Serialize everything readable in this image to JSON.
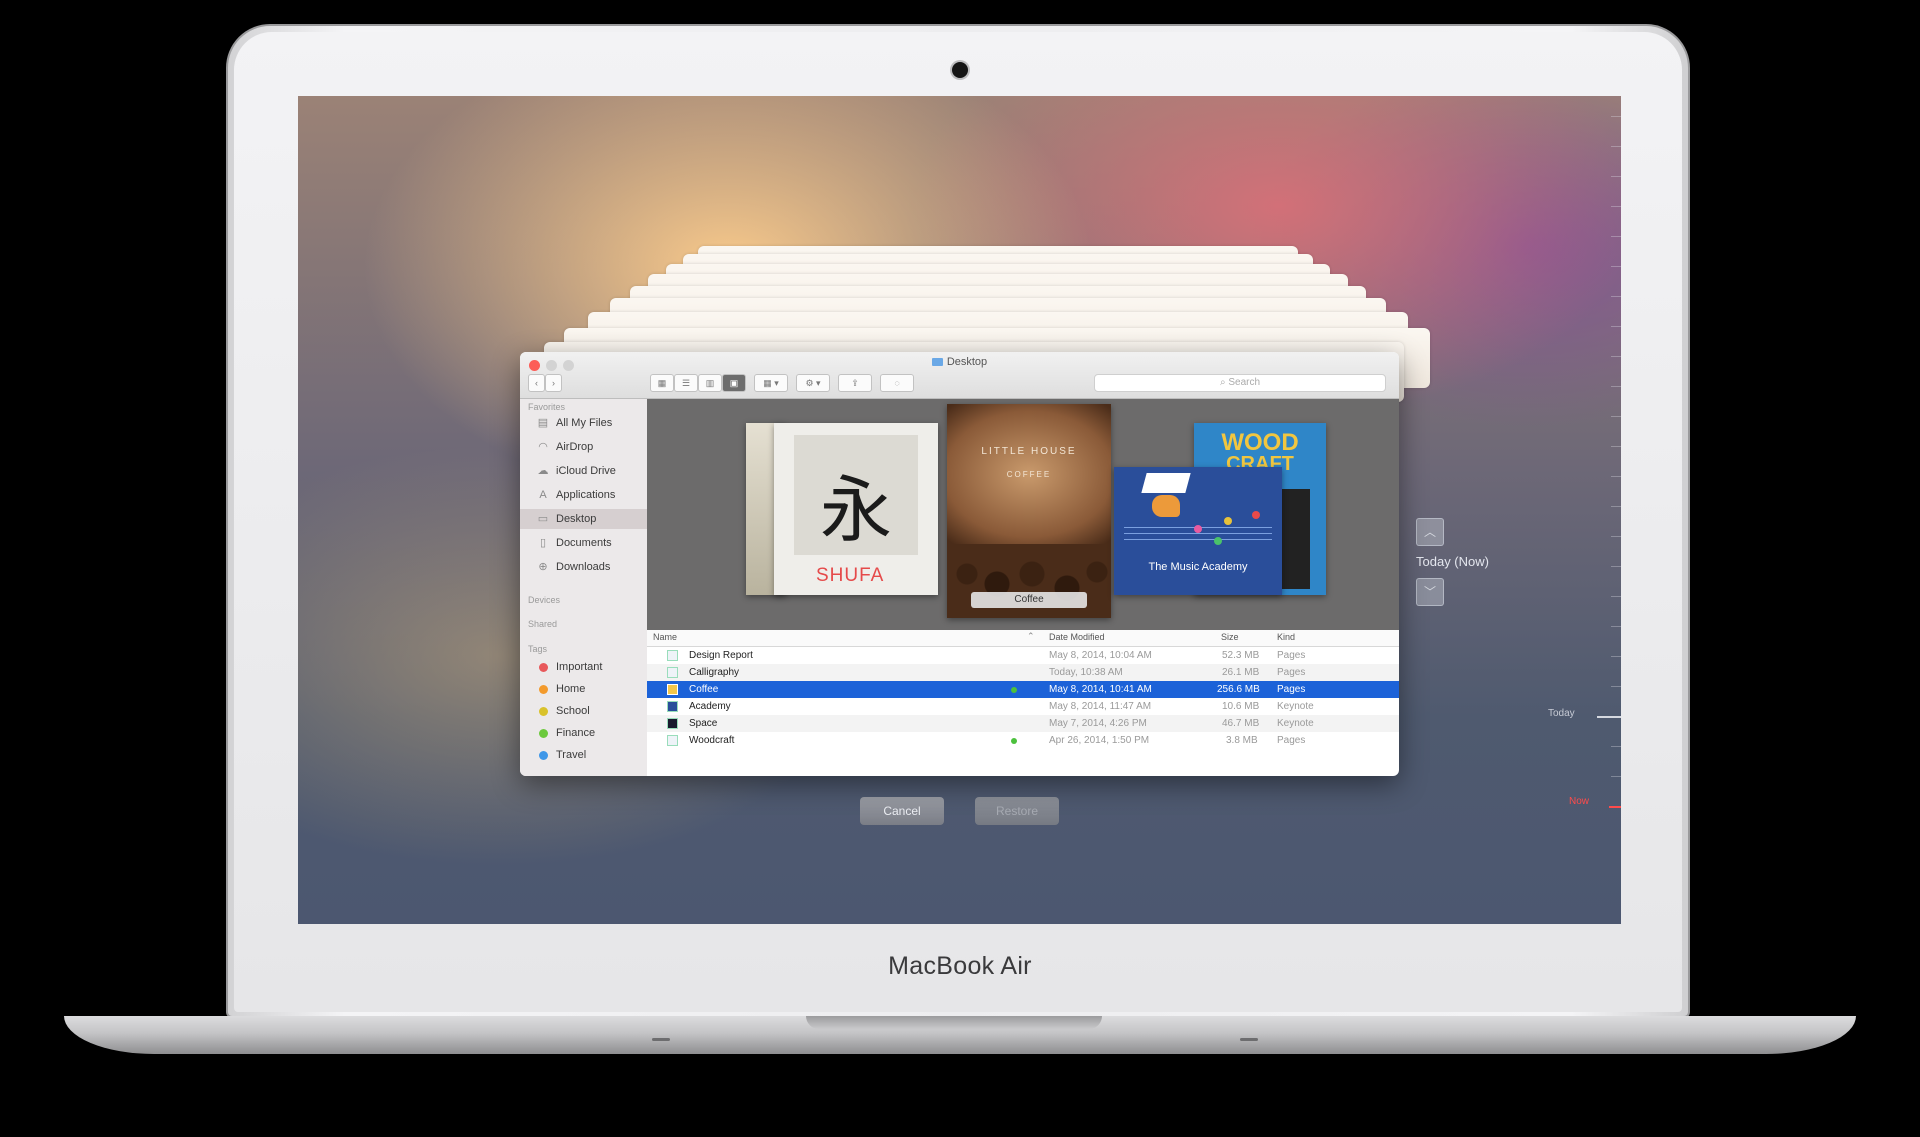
{
  "device": {
    "brand_label": "MacBook Air"
  },
  "finder": {
    "window_title": "Desktop",
    "search_placeholder": "Search",
    "sidebar": {
      "favorites_header": "Favorites",
      "favorites": [
        {
          "label": "All My Files",
          "icon": "all-files-icon"
        },
        {
          "label": "AirDrop",
          "icon": "airdrop-icon"
        },
        {
          "label": "iCloud Drive",
          "icon": "cloud-icon"
        },
        {
          "label": "Applications",
          "icon": "applications-icon"
        },
        {
          "label": "Desktop",
          "icon": "desktop-icon"
        },
        {
          "label": "Documents",
          "icon": "documents-icon"
        },
        {
          "label": "Downloads",
          "icon": "downloads-icon"
        }
      ],
      "devices_header": "Devices",
      "shared_header": "Shared",
      "tags_header": "Tags",
      "tags": [
        {
          "label": "Important",
          "color": "#e8585b"
        },
        {
          "label": "Home",
          "color": "#f39a2c"
        },
        {
          "label": "School",
          "color": "#d9c22b"
        },
        {
          "label": "Finance",
          "color": "#6cc93d"
        },
        {
          "label": "Travel",
          "color": "#3f97e8"
        }
      ]
    },
    "cover_flow": {
      "shufa_title": "SHUFA",
      "shufa_glyph": "永",
      "coffee_caption": "Coffee",
      "coffee_arc": "LITTLE HOUSE",
      "coffee_sub": "COFFEE",
      "music_title": "The Music Academy",
      "wood_title": "WOOD",
      "wood_sub": "CRAFT"
    },
    "list": {
      "columns": {
        "name": "Name",
        "date": "Date Modified",
        "size": "Size",
        "kind": "Kind"
      },
      "rows": [
        {
          "name": "Design Report",
          "date": "May 8, 2014, 10:04 AM",
          "size": "52.3 MB",
          "kind": "Pages"
        },
        {
          "name": "Calligraphy",
          "date": "Today, 10:38 AM",
          "size": "26.1 MB",
          "kind": "Pages"
        },
        {
          "name": "Coffee",
          "date": "May 8, 2014, 10:41 AM",
          "size": "256.6 MB",
          "kind": "Pages"
        },
        {
          "name": "Academy",
          "date": "May 8, 2014, 11:47 AM",
          "size": "10.6 MB",
          "kind": "Keynote"
        },
        {
          "name": "Space",
          "date": "May 7, 2014, 4:26 PM",
          "size": "46.7 MB",
          "kind": "Keynote"
        },
        {
          "name": "Woodcraft",
          "date": "Apr 26, 2014, 1:50 PM",
          "size": "3.8 MB",
          "kind": "Pages"
        }
      ]
    }
  },
  "time_machine": {
    "cancel_label": "Cancel",
    "restore_label": "Restore",
    "date_label": "Today (Now)",
    "timeline_today": "Today",
    "timeline_now": "Now"
  }
}
